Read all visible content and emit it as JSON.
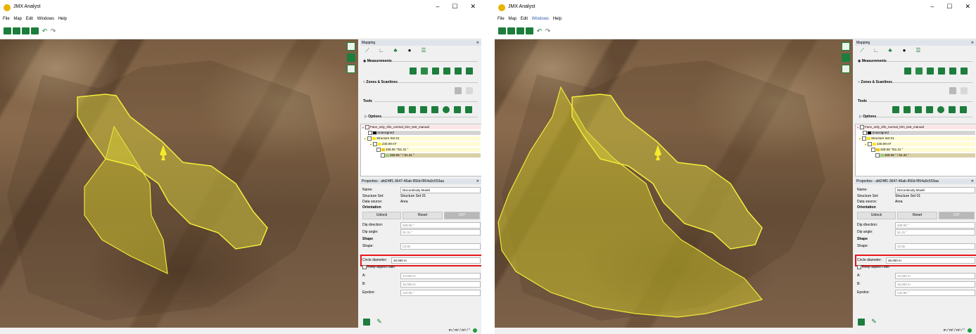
{
  "app": {
    "title": "JMX Analyst",
    "menu": [
      "File",
      "Map",
      "Edit",
      "Windows",
      "Help"
    ],
    "window_controls": [
      "–",
      "☐",
      "✕"
    ]
  },
  "mapping": {
    "header": "Mapping",
    "measurements_label": "Measurements",
    "zones_label": "Zones & Scanlines",
    "tools_label": "Tools",
    "options_label": "Options"
  },
  "tree": {
    "root": "Face_only_sfm_normal_trim_test_manual",
    "unassigned": "Unassigned",
    "set": "Structure Set 01",
    "area": "240.09 m²",
    "child": "328.06 °/51.31 °",
    "selected": "328.06 ° / 51.31 °"
  },
  "properties": {
    "header": "Properties - afd24ff1-3647-46ab-956d-f954a0c553aa",
    "name_label": "Name:",
    "name_value": "Discontinuity Model",
    "structure_set_label": "Structure Set:",
    "structure_set_value": "Structure Set 01",
    "data_source_label": "Data source:",
    "data_source_value": "Area",
    "orientation_label": "Orientation",
    "unlock_label": "Unlock",
    "reset_label": "Reset",
    "rotate_label": "180°",
    "dip_direction_label": "Dip direction:",
    "dip_direction_value": "328.06 °",
    "dip_angle_label": "Dip angle:",
    "dip_angle_value": "51.31 °",
    "shape_heading": "Shape",
    "shape_label": "Shape:",
    "shape_value": "Circle",
    "circle_diameter_label": "Circle diameter:",
    "keep_aspect_label": "Keep aspect ratio",
    "a_label": "A:",
    "a_value": "34.000 m",
    "b_label": "B:",
    "b_value": "15.000 m",
    "epsilon_label": "Epsilon:",
    "epsilon_value": "142.96 °"
  },
  "left": {
    "circle_diameter_value": "20.000 m"
  },
  "right": {
    "circle_diameter_value": "35.000 m"
  },
  "status": {
    "units": "m / m² / m³ / °"
  },
  "colors": {
    "accent": "#1c7d3c",
    "highlight": "#e8161b",
    "selection": "#f5f08c"
  }
}
